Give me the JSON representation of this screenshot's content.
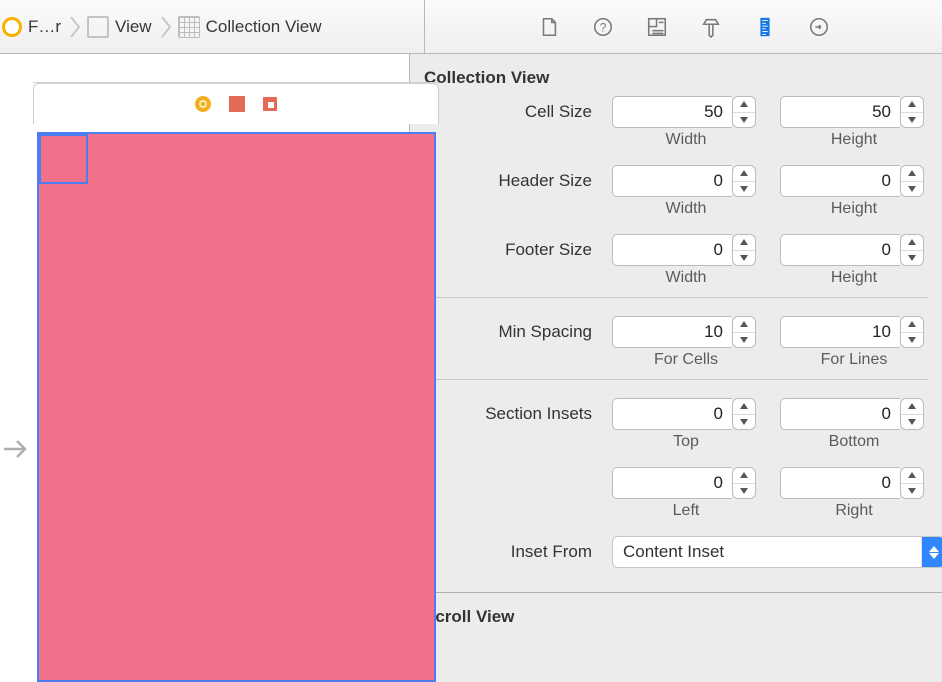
{
  "breadcrumb": [
    {
      "icon": "circle",
      "label": "F…r"
    },
    {
      "icon": "square",
      "label": "View"
    },
    {
      "icon": "grid",
      "label": "Collection View"
    }
  ],
  "inspector": {
    "section1_title": "Collection View",
    "cell": {
      "label": "Cell Size",
      "w": "50",
      "h": "50",
      "wlabel": "Width",
      "hlabel": "Height"
    },
    "header": {
      "label": "Header Size",
      "w": "0",
      "h": "0",
      "wlabel": "Width",
      "hlabel": "Height"
    },
    "footer": {
      "label": "Footer Size",
      "w": "0",
      "h": "0",
      "wlabel": "Width",
      "hlabel": "Height"
    },
    "spacing": {
      "label": "Min Spacing",
      "cells": "10",
      "lines": "10",
      "clabel": "For Cells",
      "llabel": "For Lines"
    },
    "insets": {
      "label": "Section Insets",
      "top": "0",
      "bottom": "0",
      "left": "0",
      "right": "0",
      "toplabel": "Top",
      "bottomlabel": "Bottom",
      "leftlabel": "Left",
      "rightlabel": "Right"
    },
    "insetfrom": {
      "label": "Inset From",
      "value": "Content Inset"
    },
    "section2_title": "Scroll View"
  }
}
